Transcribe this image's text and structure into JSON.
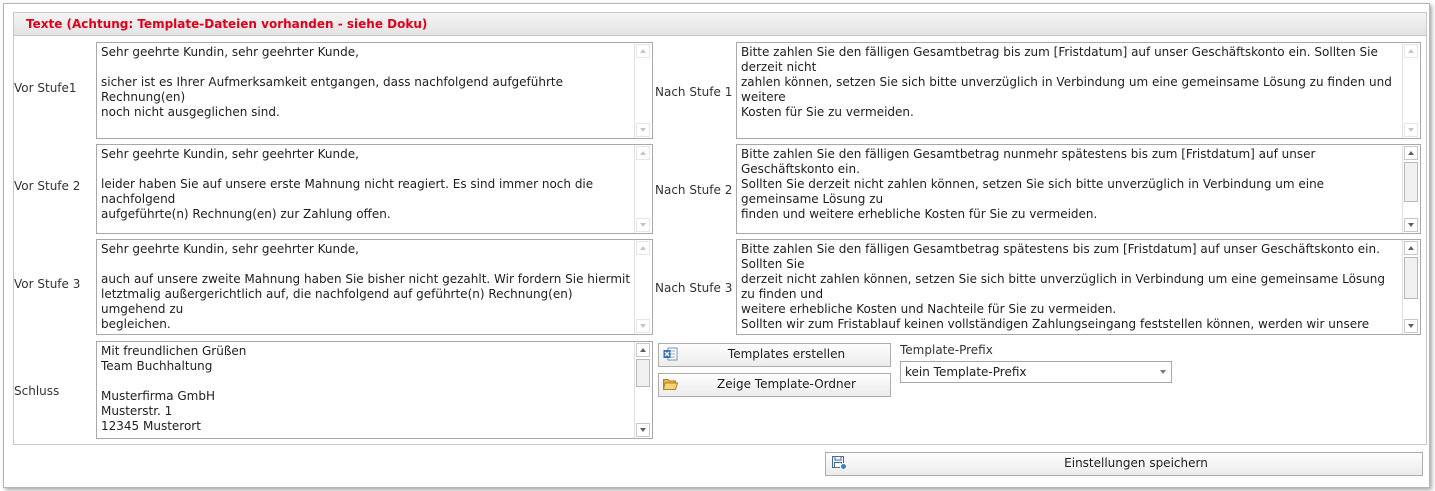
{
  "group": {
    "title": "Texte (Achtung: Template-Dateien vorhanden - siehe Doku)"
  },
  "vor": {
    "stufe1_label": "Vor Stufe1",
    "stufe1_text": "Sehr geehrte Kundin, sehr geehrter Kunde,\n\nsicher ist es Ihrer Aufmerksamkeit entgangen, dass nachfolgend aufgeführte Rechnung(en)\nnoch nicht ausgeglichen sind.",
    "stufe2_label": "Vor Stufe 2",
    "stufe2_text": "Sehr geehrte Kundin, sehr geehrter Kunde,\n\nleider haben Sie auf unsere erste Mahnung nicht reagiert. Es sind immer noch die nachfolgend\naufgeführte(n) Rechnung(en) zur Zahlung offen.",
    "stufe3_label": "Vor Stufe 3",
    "stufe3_text": "Sehr geehrte Kundin, sehr geehrter Kunde,\n\nauch auf unsere zweite Mahnung haben Sie bisher nicht gezahlt. Wir fordern Sie hiermit\nletztmalig außergerichtlich auf, die nachfolgend auf geführte(n) Rechnung(en) umgehend zu\nbegleichen."
  },
  "nach": {
    "stufe1_label": "Nach Stufe 1",
    "stufe1_text": "Bitte zahlen Sie den fälligen Gesamtbetrag bis zum [Fristdatum] auf unser Geschäftskonto ein. Sollten Sie derzeit nicht\nzahlen können, setzen Sie sich bitte unverzüglich in Verbindung um eine gemeinsame Lösung zu finden und weitere\nKosten für Sie zu vermeiden.\n\nSollten Sie bereits gezahlt haben, senden Sie uns bitte eine Information, wann Sie mit welchem Verwendungszweck\nbezahlt haben.",
    "stufe2_label": "Nach Stufe 2",
    "stufe2_text": "Bitte zahlen Sie den fälligen Gesamtbetrag nunmehr spätestens bis zum [Fristdatum] auf unser Geschäftskonto ein.\nSollten Sie derzeit nicht zahlen können, setzen Sie sich bitte unverzüglich in Verbindung um eine gemeinsame Lösung zu\nfinden und weitere erhebliche Kosten für Sie zu vermeiden.\n\nSollten Sie bereits gezahlt haben, senden Sie uns bitte eine Information, wann Sie mit welchem Verwendungszweck\nbezahlt haben.",
    "stufe3_label": "Nach Stufe 3",
    "stufe3_text": "Bitte zahlen Sie den fälligen Gesamtbetrag spätestens bis zum [Fristdatum] auf unser Geschäftskonto ein. Sollten Sie\nderzeit nicht zahlen können, setzen Sie sich bitte unverzüglich in Verbindung um eine gemeinsame Lösung zu finden und\nweitere erhebliche Kosten und Nachteile für Sie zu vermeiden.\nSollten wir zum Fristablauf keinen vollständigen Zahlungseingang feststellen können, werden wir unsere Forderung zum\ngerichtlichen Mahnverfahren an unsere Rechtsanwaltskanzlei abgeben. Wir hoffen, dass die nicht notwendig werden\nwird."
  },
  "schluss": {
    "label": "Schluss",
    "text": "Mit freundlichen Grüßen\nTeam Buchhaltung\n\nMusterfirma GmbH\nMusterstr. 1\n12345 Musterort"
  },
  "buttons": {
    "templates_erstellen": "Templates erstellen",
    "zeige_template_ordner": "Zeige Template-Ordner",
    "einstellungen_speichern": "Einstellungen speichern"
  },
  "template_prefix": {
    "label": "Template-Prefix",
    "value": "kein Template-Prefix"
  },
  "icons": {
    "templates_erstellen": "excel-template-icon",
    "zeige_template_ordner": "folder-open-icon",
    "einstellungen_speichern": "save-settings-icon"
  },
  "colors": {
    "group_title": "#e0001b"
  }
}
